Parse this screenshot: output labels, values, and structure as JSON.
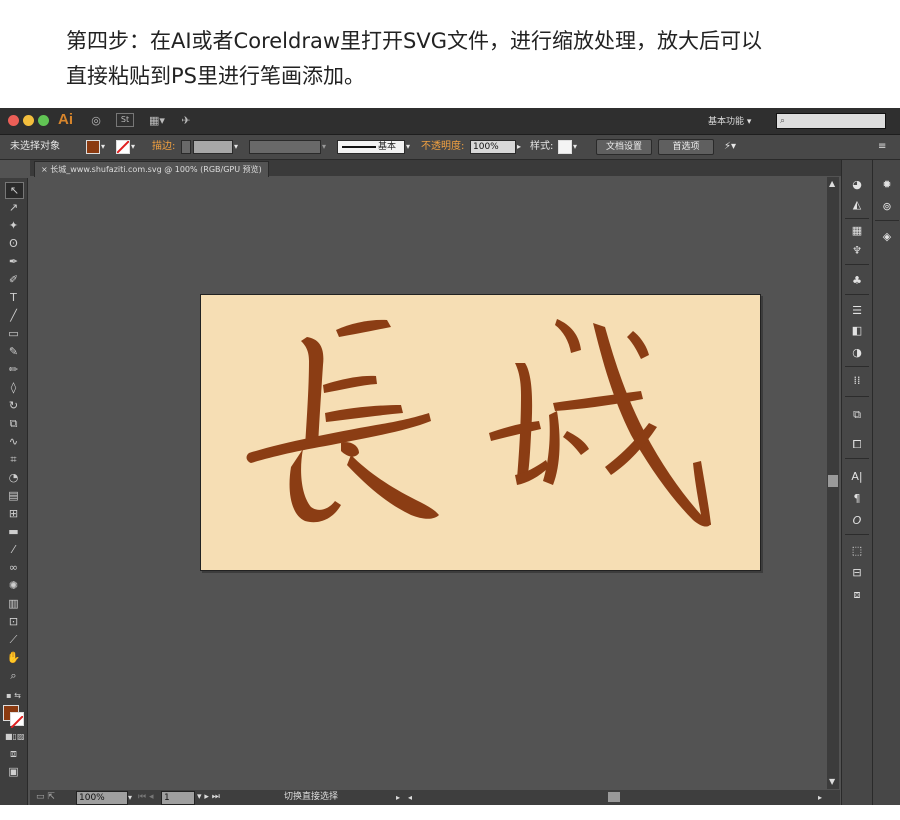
{
  "caption": {
    "line1": "第四步：在AI或者Coreldraw里打开SVG文件，进行缩放处理，放大后可以",
    "line2": "直接粘贴到PS里进行笔画添加。"
  },
  "app": {
    "logo": "Ai",
    "workspace_label": "基本功能",
    "workspace_arrow": "▾",
    "search_icon": "⌕"
  },
  "control_bar": {
    "selection_label": "未选择对象",
    "stroke_label": "描边:",
    "stroke_profile": "基本",
    "opacity_label": "不透明度:",
    "opacity_value": "100%",
    "style_label": "样式:",
    "doc_setup_button": "文档设置",
    "preferences_button": "首选项",
    "fill_color": "#8b3a10"
  },
  "document": {
    "tab_label": "长城_www.shufaziti.com.svg @ 100% (RGB/GPU 预览)",
    "tab_close": "×",
    "artboard_color": "#f6deb4",
    "glyph_color": "#8b3d14"
  },
  "status_bar": {
    "zoom": "100%",
    "page_num": "1",
    "status_text": "切换直接选择"
  },
  "tools": [
    "selection-tool",
    "direct-selection-tool",
    "magic-wand-tool",
    "lasso-tool",
    "pen-tool",
    "curvature-tool",
    "type-tool",
    "line-tool",
    "rectangle-tool",
    "paintbrush-tool",
    "pencil-tool",
    "eraser-tool",
    "rotate-tool",
    "scale-tool",
    "warp-tool",
    "free-transform-tool",
    "shape-builder-tool",
    "perspective-grid-tool",
    "mesh-tool",
    "gradient-tool",
    "eyedropper-tool",
    "blend-tool",
    "symbol-sprayer-tool",
    "column-graph-tool",
    "artboard-tool",
    "slice-tool",
    "hand-tool",
    "zoom-tool"
  ]
}
